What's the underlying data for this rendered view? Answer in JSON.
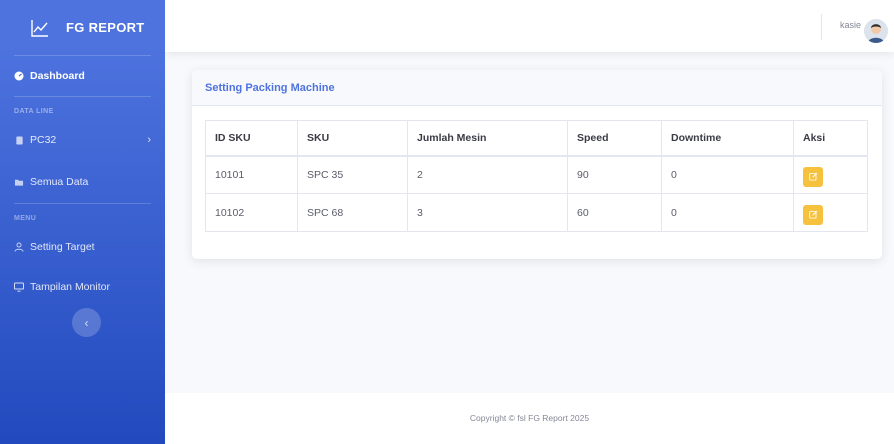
{
  "brand": {
    "title": "FG REPORT"
  },
  "sidebar": {
    "dashboard": "Dashboard",
    "heading_data_line": "DATA LINE",
    "pc32": "PC32",
    "semua_data": "Semua Data",
    "heading_menu": "MENU",
    "setting_target": "Setting Target",
    "tampilan_monitor": "Tampilan Monitor"
  },
  "topbar": {
    "username": "kasie"
  },
  "card": {
    "title": "Setting Packing Machine"
  },
  "table": {
    "headers": [
      "ID SKU",
      "SKU",
      "Jumlah Mesin",
      "Speed",
      "Downtime",
      "Aksi"
    ],
    "rows": [
      [
        "10101",
        "SPC 35",
        "2",
        "90",
        "0"
      ],
      [
        "10102",
        "SPC 68",
        "3",
        "60",
        "0"
      ]
    ]
  },
  "footer": {
    "copyright": "Copyright © fsl FG Report 2025"
  },
  "colors": {
    "primary": "#4e73df",
    "warning": "#f6c23e"
  }
}
